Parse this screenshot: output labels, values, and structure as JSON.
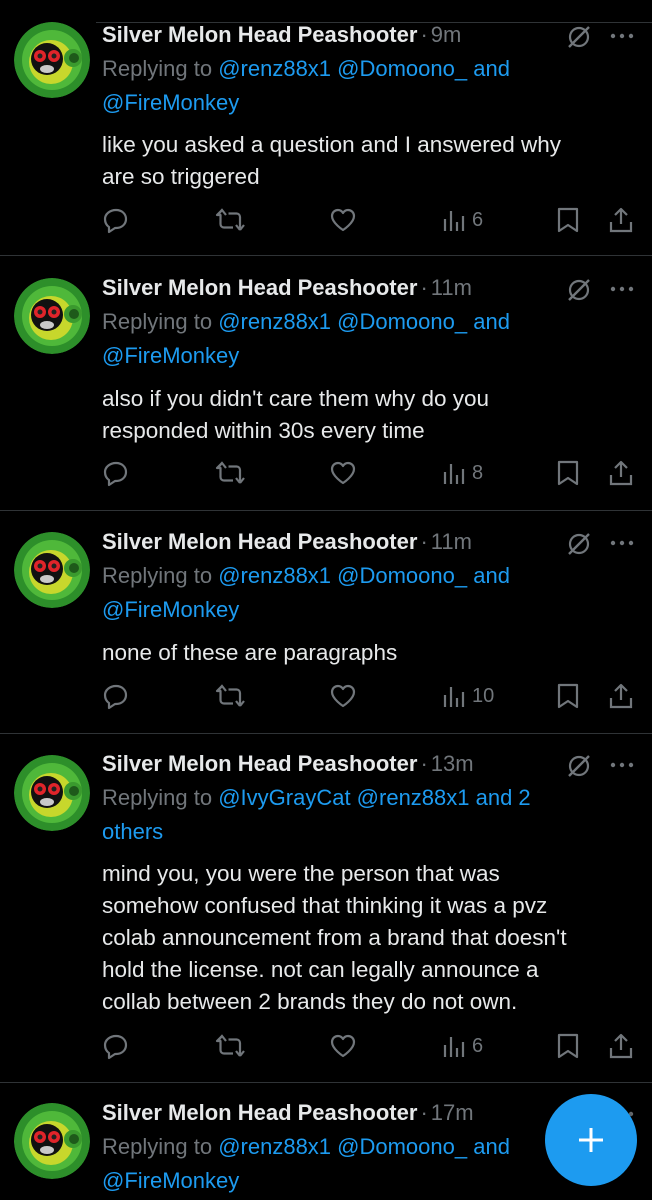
{
  "tweets": [
    {
      "name": "Silver Melon Head Peashooter",
      "time": "9m",
      "replying_prefix": "Replying to",
      "replying_line1": "@renz88x1 @Domoono_ and",
      "replying_line2": "@FireMonkey",
      "text": "like you asked a question and I answered why\nare so triggered",
      "views": "6"
    },
    {
      "name": "Silver Melon Head Peashooter",
      "time": "11m",
      "replying_prefix": "Replying to",
      "replying_line1": "@renz88x1 @Domoono_ and",
      "replying_line2": "@FireMonkey",
      "text": "also if you didn't care them why do you\nresponded within 30s every time",
      "views": "8"
    },
    {
      "name": "Silver Melon Head Peashooter",
      "time": "11m",
      "replying_prefix": "Replying to",
      "replying_line1": "@renz88x1 @Domoono_ and",
      "replying_line2": "@FireMonkey",
      "text": "none of these are paragraphs",
      "views": "10"
    },
    {
      "name": "Silver Melon Head Peashooter",
      "time": "13m",
      "replying_prefix": "Replying to",
      "replying_line1": "@IvyGrayCat @renz88x1 and 2",
      "replying_line2": "others",
      "text": "mind you, you were the person that was\nsomehow confused that thinking it was a pvz\ncolab announcement from a brand that doesn't\nhold the license. not can legally announce a\ncollab between 2 brands they do not own.",
      "views": "6"
    },
    {
      "name": "Silver Melon Head Peashooter",
      "time": "17m",
      "replying_prefix": "Replying to",
      "replying_line1": "@renz88x1 @Domoono_ and",
      "replying_line2": "@FireMonkey"
    }
  ],
  "fab": {
    "icon": "plus-icon",
    "color": "#1d9bf0"
  },
  "colors": {
    "accent": "#1d9bf0",
    "muted": "#71767b",
    "text": "#e7e9ea",
    "divider": "#2f3336"
  }
}
